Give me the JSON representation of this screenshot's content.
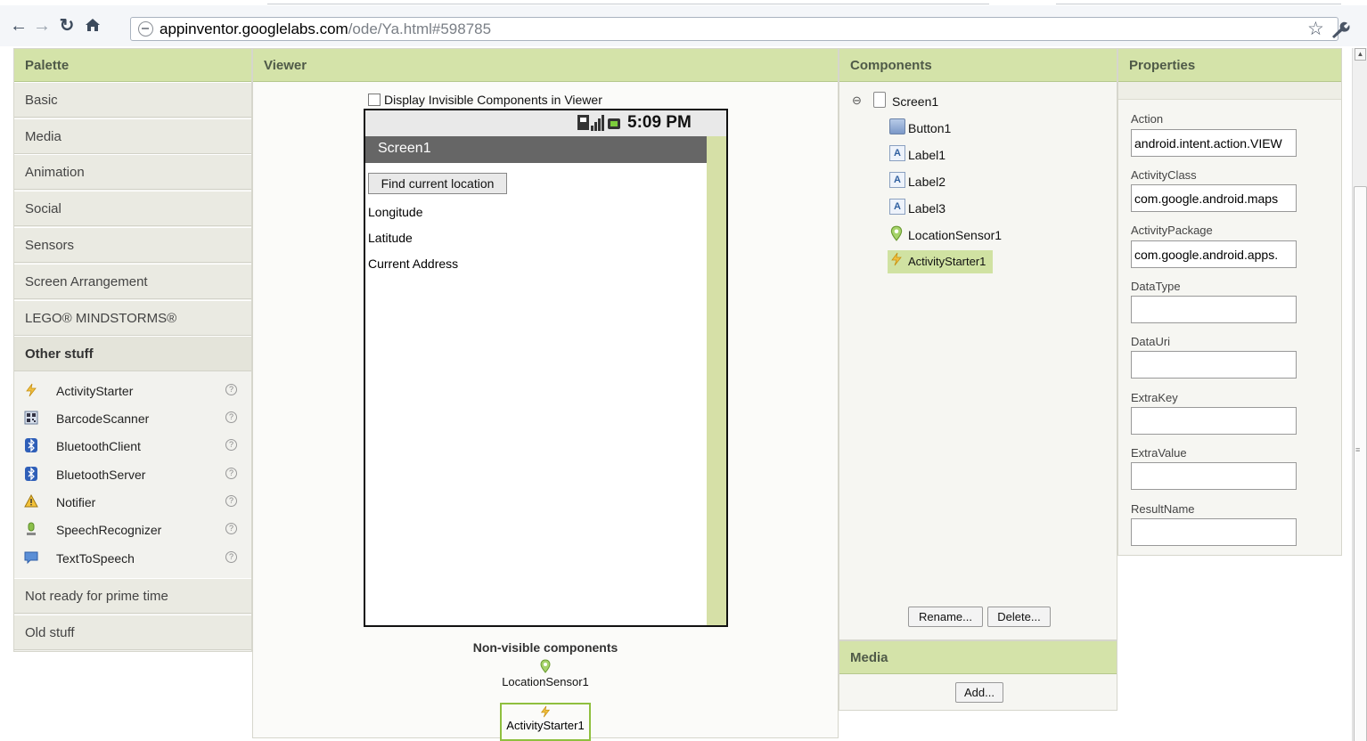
{
  "browser": {
    "url_host": "appinventor.googlelabs.com",
    "url_path": "/ode/Ya.html#598785"
  },
  "palette": {
    "title": "Palette",
    "categories_top": [
      "Basic",
      "Media",
      "Animation",
      "Social",
      "Sensors",
      "Screen Arrangement",
      "LEGO® MINDSTORMS®"
    ],
    "open_category": "Other stuff",
    "items": [
      {
        "name": "ActivityStarter",
        "icon": "activity-starter-icon"
      },
      {
        "name": "BarcodeScanner",
        "icon": "barcode-scanner-icon"
      },
      {
        "name": "BluetoothClient",
        "icon": "bluetooth-icon"
      },
      {
        "name": "BluetoothServer",
        "icon": "bluetooth-icon"
      },
      {
        "name": "Notifier",
        "icon": "notifier-icon"
      },
      {
        "name": "SpeechRecognizer",
        "icon": "speech-recognizer-icon"
      },
      {
        "name": "TextToSpeech",
        "icon": "text-to-speech-icon"
      }
    ],
    "help_glyph": "?",
    "categories_bottom": [
      "Not ready for prime time",
      "Old stuff"
    ]
  },
  "viewer": {
    "title": "Viewer",
    "display_invisible_label": "Display Invisible Components in Viewer",
    "display_invisible_checked": false,
    "phone": {
      "time": "5:09 PM",
      "screen_title": "Screen1",
      "button_label": "Find current location",
      "labels": [
        "Longitude",
        "Latitude",
        "Current Address"
      ]
    },
    "nonvisible_title": "Non-visible components",
    "nonvisible_items": [
      "LocationSensor1",
      "ActivityStarter1"
    ]
  },
  "components": {
    "title": "Components",
    "collapse_glyph": "⊖",
    "root": "Screen1",
    "children": [
      {
        "name": "Button1",
        "icon": "button-icon",
        "selected": false
      },
      {
        "name": "Label1",
        "icon": "label-icon",
        "selected": false
      },
      {
        "name": "Label2",
        "icon": "label-icon",
        "selected": false
      },
      {
        "name": "Label3",
        "icon": "label-icon",
        "selected": false
      },
      {
        "name": "LocationSensor1",
        "icon": "location-sensor-icon",
        "selected": false
      },
      {
        "name": "ActivityStarter1",
        "icon": "activity-starter-icon",
        "selected": true
      }
    ],
    "rename_label": "Rename...",
    "delete_label": "Delete..."
  },
  "media": {
    "title": "Media",
    "add_label": "Add..."
  },
  "properties": {
    "title": "Properties",
    "fields": [
      {
        "label": "Action",
        "value": "android.intent.action.VIEW"
      },
      {
        "label": "ActivityClass",
        "value": "com.google.android.maps"
      },
      {
        "label": "ActivityPackage",
        "value": "com.google.android.apps."
      },
      {
        "label": "DataType",
        "value": ""
      },
      {
        "label": "DataUri",
        "value": ""
      },
      {
        "label": "ExtraKey",
        "value": ""
      },
      {
        "label": "ExtraValue",
        "value": ""
      },
      {
        "label": "ResultName",
        "value": ""
      }
    ]
  },
  "colors": {
    "header_green": "#d4e3a9",
    "selection_green": "#d0e2a2",
    "phone_titlebar": "#666666"
  }
}
